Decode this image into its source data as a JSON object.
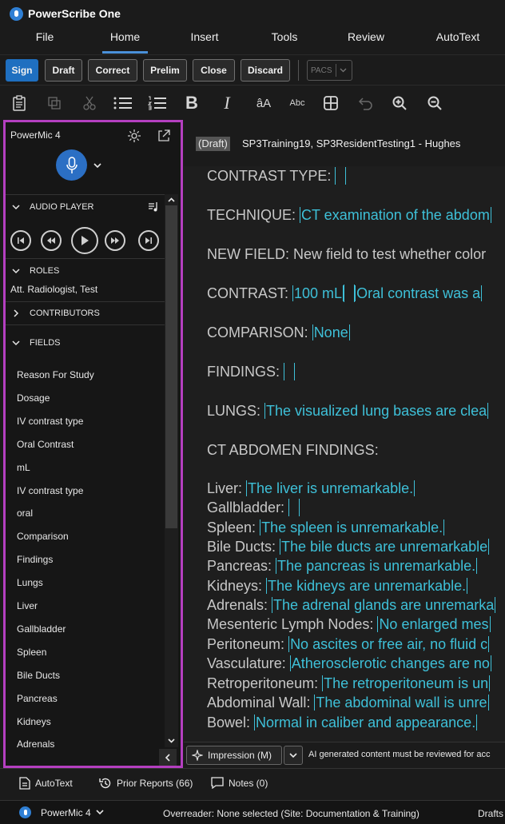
{
  "app": {
    "title": "PowerScribe One"
  },
  "menu": [
    "File",
    "Home",
    "Insert",
    "Tools",
    "Review",
    "AutoText"
  ],
  "menu_active": "Home",
  "actions": {
    "sign": "Sign",
    "draft": "Draft",
    "correct": "Correct",
    "prelim": "Prelim",
    "close": "Close",
    "discard": "Discard",
    "pacs": "PACS"
  },
  "toolbar": {
    "bold": "B",
    "italic": "I",
    "font_size": "âA",
    "case": "Abc"
  },
  "panel": {
    "title": "PowerMic 4",
    "audio_player": "AUDIO PLAYER",
    "roles": "ROLES",
    "role_value": "Att. Radiologist, Test",
    "contributors": "CONTRIBUTORS",
    "fields_title": "FIELDS",
    "fields": [
      "Reason For Study",
      "Dosage",
      "IV contrast type",
      "Oral Contrast",
      "mL",
      "IV contrast type",
      "oral",
      "Comparison",
      "Findings",
      "Lungs",
      "Liver",
      "Gallbladder",
      "Spleen",
      "Bile Ducts",
      "Pancreas",
      "Kidneys",
      "Adrenals"
    ]
  },
  "doc": {
    "draft_tag": "(Draft)",
    "title": "SP3Training19, SP3ResidentTesting1 - Hughes",
    "lines": [
      {
        "label": "CONTRAST TYPE: ",
        "values": [
          ""
        ]
      },
      {
        "label": "TECHNIQUE: ",
        "values": [
          "CT examination of the abdom"
        ]
      },
      {
        "label": "NEW FIELD: New field to test whether color",
        "values": []
      },
      {
        "label": "CONTRAST: ",
        "values": [
          "100 mL",
          "",
          "Oral contrast was a"
        ]
      },
      {
        "label": "COMPARISON: ",
        "values": [
          "None"
        ]
      },
      {
        "label": "FINDINGS: ",
        "values": [
          ""
        ]
      },
      {
        "label": "LUNGS: ",
        "values": [
          "The visualized lung bases are clea"
        ]
      },
      {
        "label": "CT ABDOMEN FINDINGS:",
        "values": []
      },
      {
        "label": "Liver: ",
        "values": [
          "The liver is unremarkable."
        ]
      },
      {
        "label": "Gallbladder: ",
        "values": [
          ""
        ]
      },
      {
        "label": "Spleen: ",
        "values": [
          "The spleen is unremarkable."
        ]
      },
      {
        "label": "Bile Ducts: ",
        "values": [
          "The bile ducts are unremarkable"
        ]
      },
      {
        "label": "Pancreas: ",
        "values": [
          "The pancreas is unremarkable."
        ]
      },
      {
        "label": "Kidneys: ",
        "values": [
          "The kidneys are unremarkable."
        ]
      },
      {
        "label": "Adrenals: ",
        "values": [
          "The adrenal glands are unremarka"
        ]
      },
      {
        "label": "Mesenteric Lymph Nodes: ",
        "values": [
          "No enlarged mes"
        ]
      },
      {
        "label": "Peritoneum: ",
        "values": [
          "No ascites or free air, no fluid c"
        ]
      },
      {
        "label": "Vasculature: ",
        "values": [
          "Atherosclerotic changes are no"
        ]
      },
      {
        "label": "Retroperitoneum: ",
        "values": [
          "The retroperitoneum is un"
        ]
      },
      {
        "label": "Abdominal Wall: ",
        "values": [
          "The abdominal wall is unre"
        ]
      },
      {
        "label": "Bowel: ",
        "values": [
          "Normal in caliber and appearance."
        ]
      }
    ]
  },
  "impression": {
    "button": "Impression (M)",
    "note": "AI generated content must be reviewed for acc"
  },
  "bottom": {
    "autotext": "AutoText",
    "prior_reports": "Prior Reports (66)",
    "notes": "Notes (0)"
  },
  "status": {
    "powermic": "PowerMic 4",
    "overreader": "Overreader: None selected (Site: Documentation & Training)",
    "drafts": "Drafts"
  },
  "colors": {
    "accent": "#1f6fc0",
    "panel_border": "#b43fc0",
    "field_value": "#3ec0d8"
  }
}
